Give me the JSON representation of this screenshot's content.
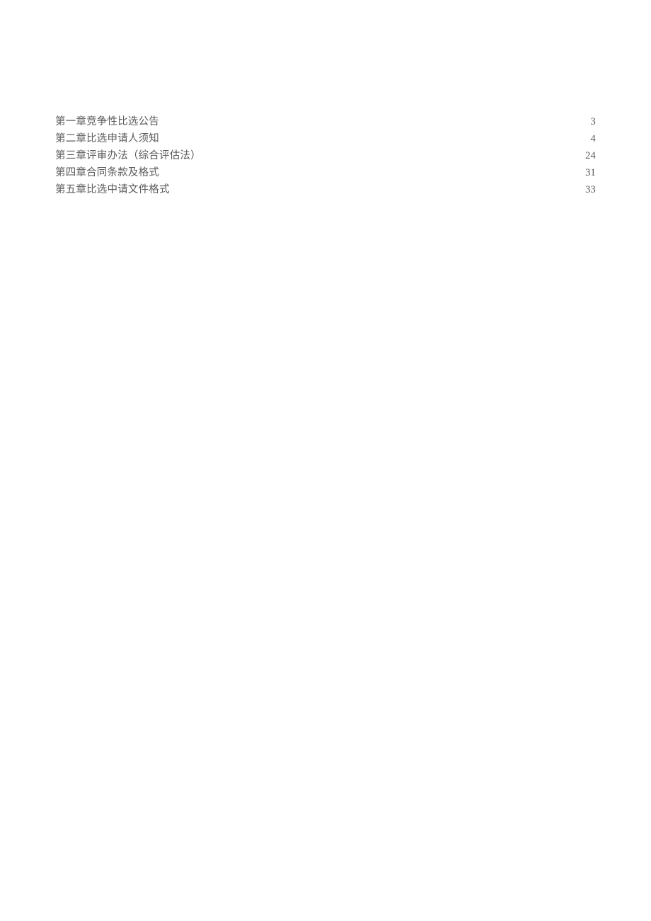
{
  "toc": {
    "entries": [
      {
        "title": "第一章竞争性比选公告",
        "page": "3"
      },
      {
        "title": "第二章比选申请人须知",
        "page": "4"
      },
      {
        "title": "第三章评审办法（综合评估法）",
        "page": "24"
      },
      {
        "title": "第四章合同条款及格式",
        "page": "31"
      },
      {
        "title": "第五章比选中请文件格式",
        "page": "33"
      }
    ]
  }
}
